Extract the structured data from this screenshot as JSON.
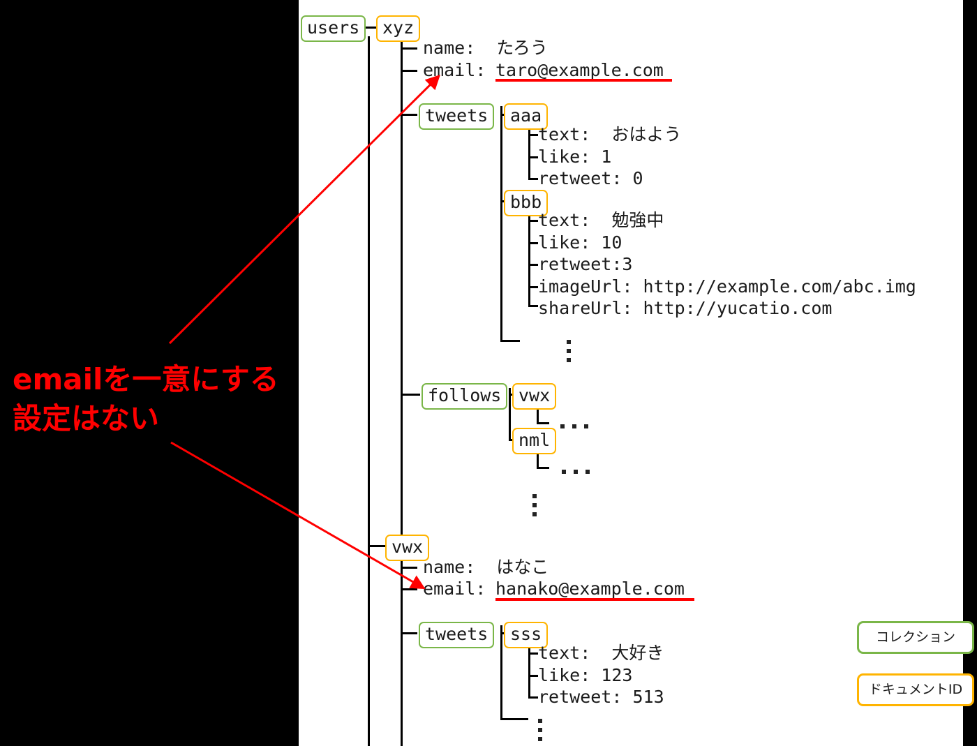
{
  "diagram": {
    "title": "Firestore users collection tree",
    "root_collection": "users",
    "colors": {
      "collection_border": "#7ab648",
      "document_border": "#ffb400",
      "annotation": "#ff0000",
      "line": "#000000",
      "mask": "#000000",
      "background": "#ffffff"
    },
    "users": [
      {
        "doc_id": "xyz",
        "fields": [
          {
            "label": "name:",
            "value": "たろう"
          },
          {
            "label": "email:",
            "value": "taro@example.com",
            "underlined": true
          }
        ],
        "subcollections": [
          {
            "name": "tweets",
            "docs": [
              {
                "doc_id": "aaa",
                "fields": [
                  {
                    "label": "text:",
                    "value": "おはよう"
                  },
                  {
                    "label": "like:",
                    "value": "1"
                  },
                  {
                    "label": "retweet:",
                    "value": "0"
                  }
                ]
              },
              {
                "doc_id": "bbb",
                "fields": [
                  {
                    "label": "text:",
                    "value": "勉強中"
                  },
                  {
                    "label": "like:",
                    "value": "10"
                  },
                  {
                    "label": "retweet:3",
                    "value": ""
                  },
                  {
                    "label": "imageUrl:",
                    "value": "http://example.com/abc.img"
                  },
                  {
                    "label": "shareUrl:",
                    "value": "http://yucatio.com"
                  }
                ]
              }
            ],
            "more": "⋮"
          },
          {
            "name": "follows",
            "docs": [
              {
                "doc_id": "vwx",
                "more": "..."
              },
              {
                "doc_id": "nml",
                "more": "..."
              }
            ],
            "more": "⋮"
          }
        ]
      },
      {
        "doc_id": "vwx",
        "fields": [
          {
            "label": "name:",
            "value": "はなこ"
          },
          {
            "label": "email:",
            "value": "hanako@example.com",
            "underlined": true
          }
        ],
        "subcollections": [
          {
            "name": "tweets",
            "docs": [
              {
                "doc_id": "sss",
                "fields": [
                  {
                    "label": "text:",
                    "value": "大好き"
                  },
                  {
                    "label": "like:",
                    "value": "123"
                  },
                  {
                    "label": "retweet:",
                    "value": "513"
                  }
                ]
              }
            ],
            "more": "⋮"
          }
        ]
      }
    ]
  },
  "labels": {
    "users": "users",
    "xyz": "xyz",
    "tweets_1": "tweets",
    "aaa": "aaa",
    "bbb": "bbb",
    "follows": "follows",
    "follows_vwx": "vwx",
    "follows_nml": "nml",
    "user_vwx": "vwx",
    "tweets_2": "tweets",
    "sss": "sss",
    "xyz_name": "name:  たろう",
    "xyz_email_label": "email:",
    "xyz_email_value": "taro@example.com",
    "aaa_text": "text:  おはよう",
    "aaa_like": "like: 1",
    "aaa_retweet": "retweet: 0",
    "bbb_text": "text:  勉強中",
    "bbb_like": "like: 10",
    "bbb_retweet": "retweet:3",
    "bbb_imageurl": "imageUrl: http://example.com/abc.img",
    "bbb_shareurl": "shareUrl: http://yucatio.com",
    "vwx_name": "name:  はなこ",
    "vwx_email_label": "email:",
    "vwx_email_value": "hanako@example.com",
    "sss_text": "text:  大好き",
    "sss_like": "like: 123",
    "sss_retweet": "retweet: 513"
  },
  "annotation": {
    "line1": "emailを一意にする",
    "line2": "設定はない",
    "text": "emailを一意にする\n設定はない",
    "color": "#ff0000",
    "arrows": [
      {
        "from": [
          243,
          492
        ],
        "to": [
          628,
          110
        ],
        "target": "xyz-email"
      },
      {
        "from": [
          245,
          634
        ],
        "to": [
          606,
          842
        ],
        "target": "vwx-email"
      }
    ]
  },
  "legend": {
    "collection": "コレクション",
    "document": "ドキュメントID"
  }
}
